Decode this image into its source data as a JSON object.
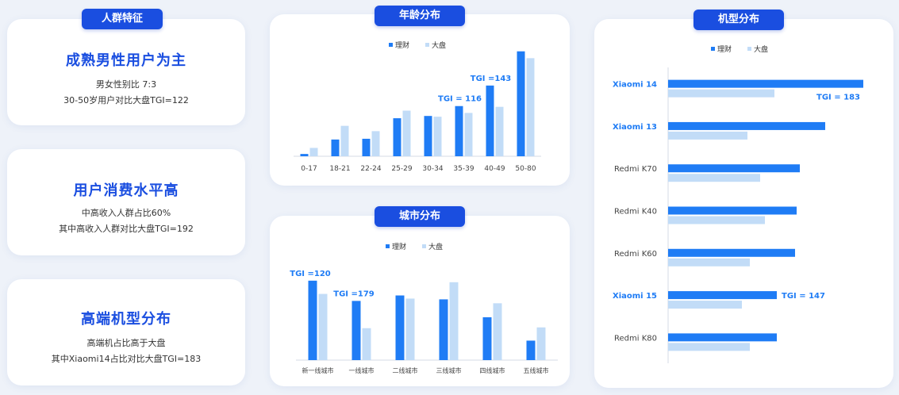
{
  "colors": {
    "primary": "#1f7cf5",
    "secondary": "#c2dcf7",
    "pill": "#1a4ee0",
    "accent_text": "#1a4ee0"
  },
  "features": {
    "pill": "人群特征",
    "cards": [
      {
        "title": "成熟男性用户为主",
        "lines": [
          "男女性别比 7:3",
          "30-50岁用户对比大盘TGI=122"
        ]
      },
      {
        "title": "用户消费水平高",
        "lines": [
          "中高收入人群占比60%",
          "其中高收入人群对比大盘TGI=192"
        ]
      },
      {
        "title": "高端机型分布",
        "lines": [
          "高端机占比高于大盘",
          "其中Xiaomi14占比对比大盘TGI=183"
        ]
      }
    ]
  },
  "chart_data": [
    {
      "id": "age",
      "pill": "年龄分布",
      "type": "bar",
      "categories": [
        "0-17",
        "18-21",
        "22-24",
        "25-29",
        "30-34",
        "35-39",
        "40-49",
        "50-80"
      ],
      "series": [
        {
          "name": "理财",
          "values": [
            3,
            22,
            23,
            50,
            53,
            66,
            93,
            138
          ]
        },
        {
          "name": "大盘",
          "values": [
            11,
            40,
            33,
            60,
            52,
            57,
            65,
            129
          ]
        }
      ],
      "ylim": [
        0,
        145
      ],
      "annotations": [
        {
          "text": "TGI = 116",
          "category": "35-39"
        },
        {
          "text": "TGI =143",
          "category": "40-49"
        }
      ],
      "grid": false,
      "legend": "top"
    },
    {
      "id": "city",
      "pill": "城市分布",
      "type": "bar",
      "categories": [
        "新一线城市",
        "一线城市",
        "二线城市",
        "三线城市",
        "四线城市",
        "五线城市"
      ],
      "series": [
        {
          "name": "理财",
          "values": [
            102,
            76,
            83,
            78,
            55,
            25
          ]
        },
        {
          "name": "大盘",
          "values": [
            85,
            41,
            79,
            100,
            73,
            42
          ]
        }
      ],
      "ylim": [
        0,
        110
      ],
      "annotations": [
        {
          "text": "TGI =120",
          "category": "新一线城市"
        },
        {
          "text": "TGI =179",
          "category": "一线城市"
        }
      ],
      "grid": false,
      "legend": "top"
    },
    {
      "id": "model",
      "pill": "机型分布",
      "type": "bar",
      "orientation": "horizontal",
      "categories": [
        "Xiaomi 14",
        "Xiaomi 13",
        "Redmi K70",
        "Redmi K40",
        "Redmi K60",
        "Xiaomi 15",
        "Redmi K80"
      ],
      "highlight": [
        "Xiaomi 14",
        "Xiaomi 13",
        "Xiaomi 15"
      ],
      "series": [
        {
          "name": "理财",
          "values": [
            246,
            198,
            166,
            162,
            160,
            137,
            137
          ]
        },
        {
          "name": "大盘",
          "values": [
            134,
            100,
            116,
            122,
            103,
            93,
            103
          ]
        }
      ],
      "xlim": [
        0,
        250
      ],
      "annotations": [
        {
          "text": "TGI = 183",
          "category": "Xiaomi 14"
        },
        {
          "text": "TGI = 147",
          "category": "Xiaomi 15"
        }
      ],
      "grid": false,
      "legend": "top"
    }
  ]
}
